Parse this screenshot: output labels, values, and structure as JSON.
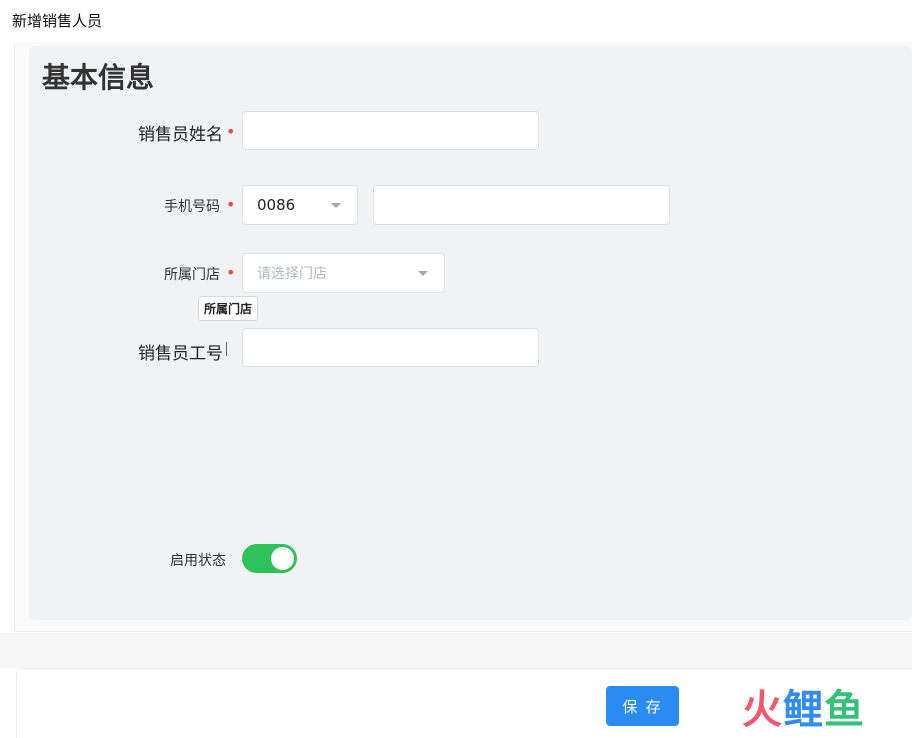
{
  "header": {
    "title": "新增销售人员"
  },
  "section": {
    "title": "基本信息"
  },
  "form": {
    "name": {
      "label": "销售员姓名",
      "required_mark": "•",
      "value": ""
    },
    "phone": {
      "label": "手机号码",
      "required_mark": "•",
      "country_code": "0086",
      "value": ""
    },
    "store": {
      "label": "所属门店",
      "required_mark": "•",
      "placeholder": "请选择门店",
      "tooltip": "所属门店"
    },
    "employee_no": {
      "label": "销售员工号",
      "value": ""
    },
    "status": {
      "label": "启用状态",
      "enabled": true
    }
  },
  "footer": {
    "save_label": "保 存"
  },
  "watermark": {
    "part1": "火",
    "part2": "鲤",
    "part3": "鱼"
  },
  "colors": {
    "accent": "#2a8bf2",
    "toggle_on": "#2fc25b",
    "required": "#f5483b"
  }
}
